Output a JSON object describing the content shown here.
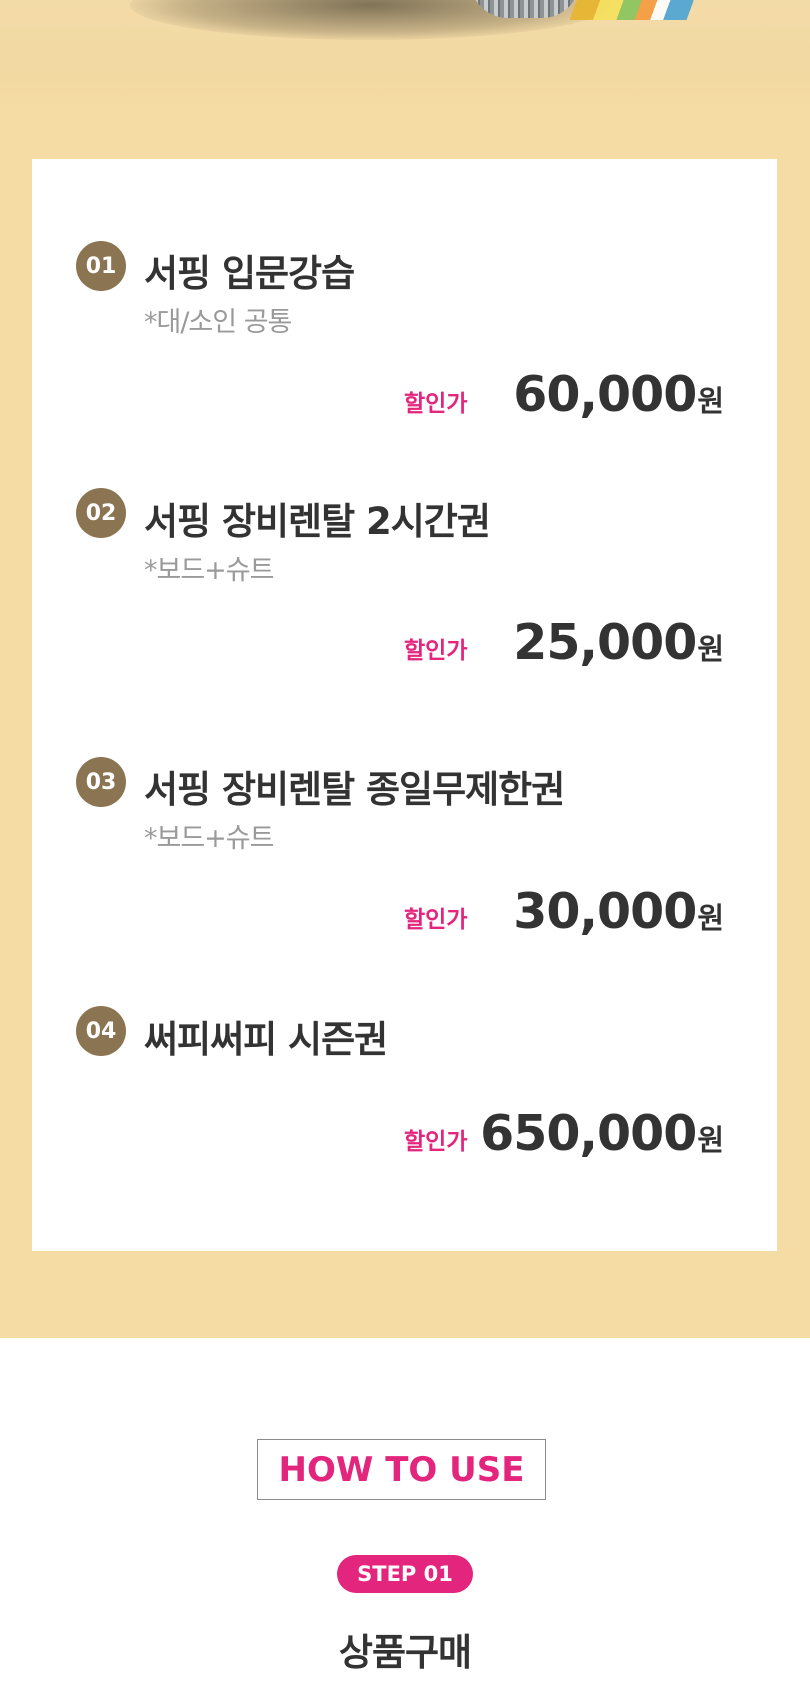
{
  "products": [
    {
      "num": "01",
      "title": "서핑 입문강습",
      "subtitle": "*대/소인 공통",
      "price_label": "할인가",
      "price": "60,000",
      "unit": "원"
    },
    {
      "num": "02",
      "title": "서핑 장비렌탈 2시간권",
      "subtitle": "*보드+슈트",
      "price_label": "할인가",
      "price": "25,000",
      "unit": "원"
    },
    {
      "num": "03",
      "title": "서핑 장비렌탈 종일무제한권",
      "subtitle": "*보드+슈트",
      "price_label": "할인가",
      "price": "30,000",
      "unit": "원"
    },
    {
      "num": "04",
      "title": "써피써피 시즌권",
      "subtitle": "",
      "price_label": "할인가",
      "price": "650,000",
      "unit": "원"
    }
  ],
  "how_to_use": {
    "heading": "HOW TO USE",
    "step_label": "STEP 01",
    "step_title": "상품구매"
  },
  "colors": {
    "accent": "#e4257d",
    "badge": "#8a7452",
    "sand": "#f5dca4"
  }
}
